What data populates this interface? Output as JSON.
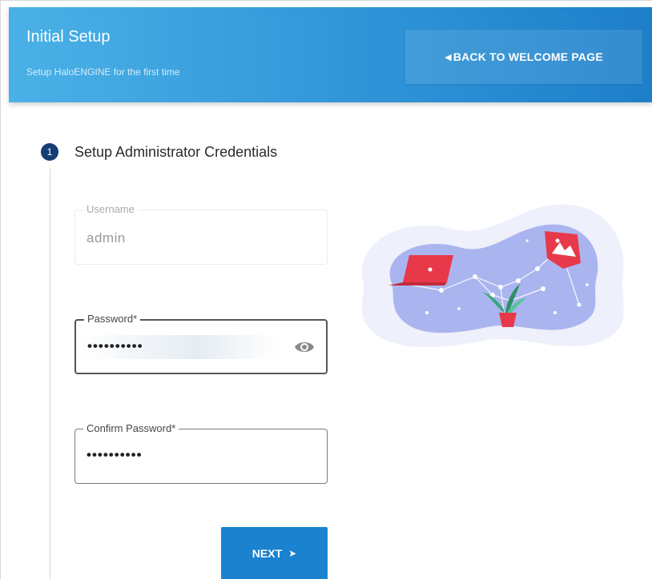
{
  "header": {
    "title": "Initial Setup",
    "subtitle": "Setup HaloENGINE for the first time",
    "back_button_label": "BACK TO WELCOME PAGE",
    "back_button_icon": "triangle-left-icon"
  },
  "step": {
    "number": "1",
    "title": "Setup Administrator Credentials"
  },
  "form": {
    "username": {
      "label": "Username",
      "value": "admin"
    },
    "password": {
      "label": "Password*",
      "value": "••••••••••",
      "toggle_icon": "eye-icon"
    },
    "confirm_password": {
      "label": "Confirm Password*",
      "value": "••••••••••"
    },
    "next_label": "NEXT",
    "next_icon": "chevron-right-icon"
  },
  "colors": {
    "header_start": "#4ab1e6",
    "header_end": "#1e7fc9",
    "step_badge": "#153e75",
    "primary_button": "#1b82cf",
    "illustration_accent": "#e8394b"
  }
}
